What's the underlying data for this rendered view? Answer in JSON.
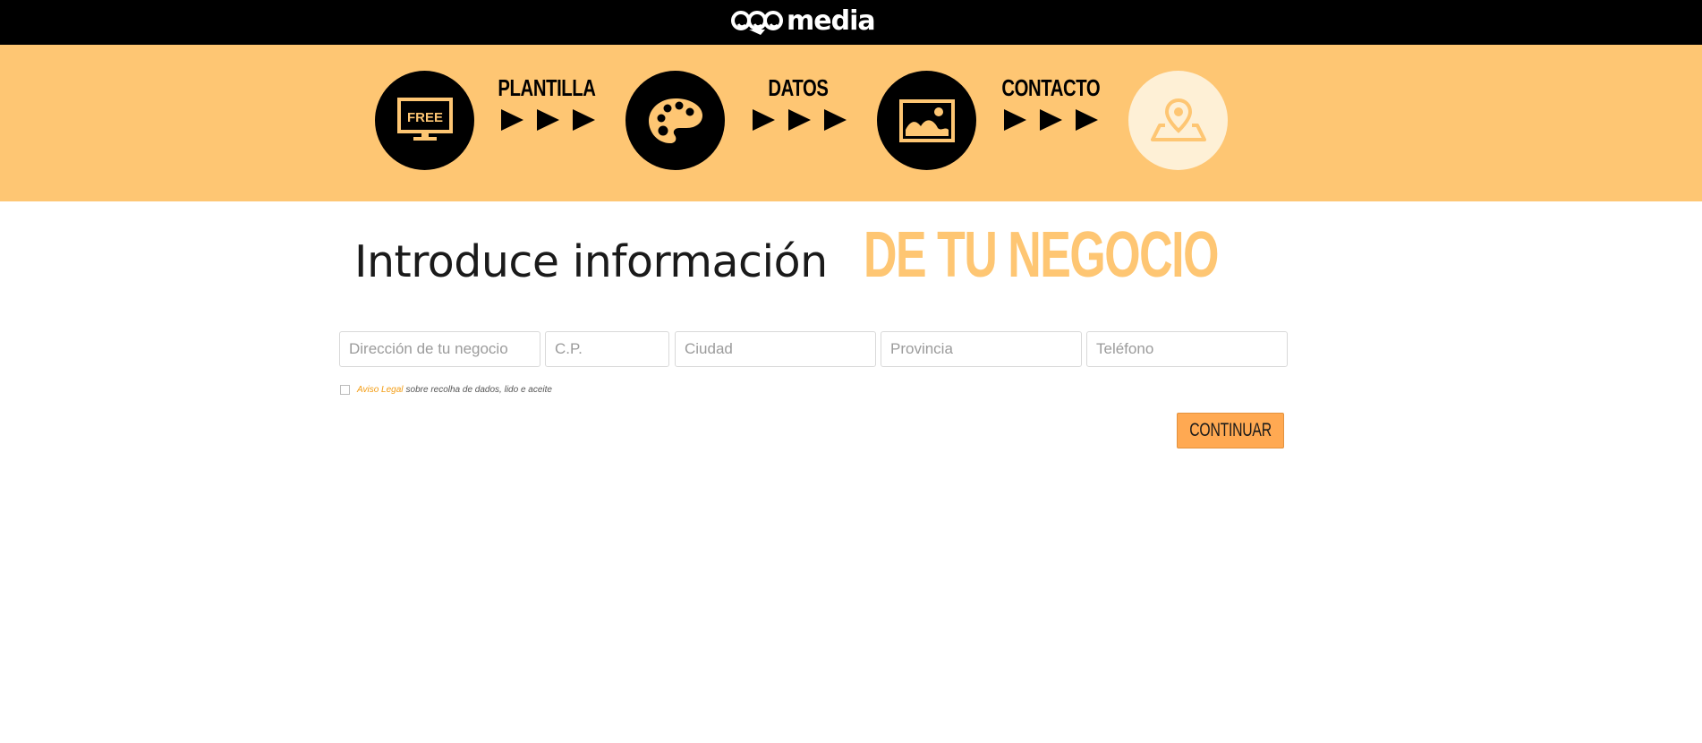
{
  "header": {
    "logo_text": "media",
    "logo_icon": "qdq-logo-icon"
  },
  "steps": [
    {
      "icon": "monitor-free-icon",
      "icon_text": "FREE",
      "active": true
    },
    {
      "label": "PLANTILLA"
    },
    {
      "icon": "palette-icon",
      "active": true
    },
    {
      "label": "DATOS"
    },
    {
      "icon": "image-icon",
      "active": true
    },
    {
      "label": "CONTACTO"
    },
    {
      "icon": "map-pin-icon",
      "active": false
    }
  ],
  "colors": {
    "accent": "#fec673",
    "button": "#ffa952",
    "inactive_step": "#fef0d6",
    "link": "#f39c12"
  },
  "heading": {
    "part1": "Introduce información",
    "part2": "DE TU NEGOCIO"
  },
  "form": {
    "address_placeholder": "Dirección de tu negocio",
    "postal_code_placeholder": "C.P.",
    "city_placeholder": "Ciudad",
    "province_placeholder": "Provincia",
    "phone_placeholder": "Teléfono",
    "legal_link": "Aviso Legal",
    "legal_text": "sobre recolha de dados, lido e aceite",
    "continue_label": "CONTINUAR"
  }
}
